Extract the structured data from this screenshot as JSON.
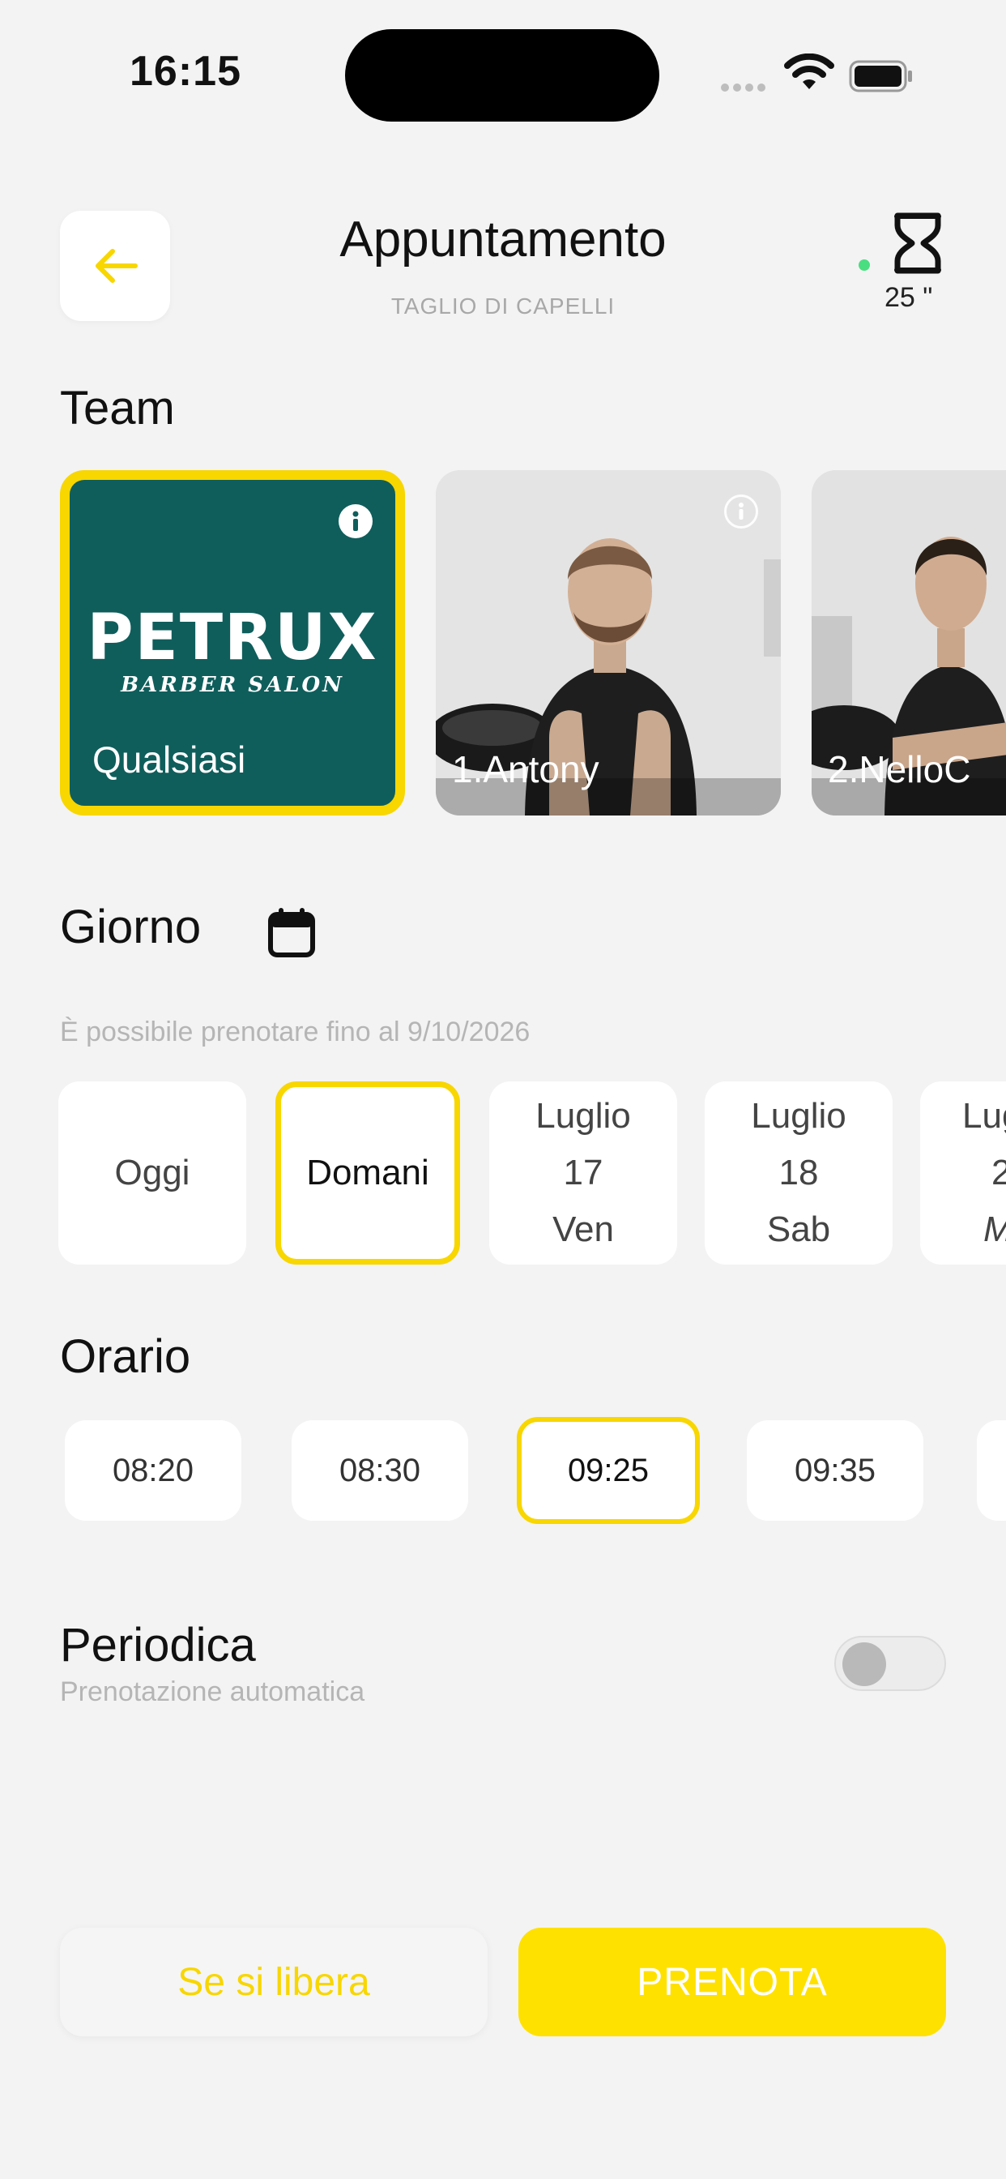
{
  "status_bar": {
    "time": "16:15"
  },
  "header": {
    "title": "Appuntamento",
    "subtitle": "TAGLIO DI CAPELLI",
    "duration": "25 \""
  },
  "team": {
    "title": "Team",
    "members": [
      {
        "name": "Qualsiasi",
        "logo": "PETRUX",
        "logo_sub": "BARBER SALON",
        "selected": true
      },
      {
        "name": "1.Antony",
        "selected": false
      },
      {
        "name": "2.NelloC",
        "selected": false
      }
    ]
  },
  "day": {
    "title": "Giorno",
    "note": "È possibile prenotare fino al 9/10/2026",
    "options": [
      {
        "line1": "Oggi"
      },
      {
        "line1": "Domani",
        "selected": true
      },
      {
        "line1": "Luglio",
        "line2": "17",
        "line3": "Ven"
      },
      {
        "line1": "Luglio",
        "line2": "18",
        "line3": "Sab"
      },
      {
        "line1": "Lug",
        "line2": "2",
        "line3": "M"
      }
    ]
  },
  "time": {
    "title": "Orario",
    "options": [
      "08:20",
      "08:30",
      "09:25",
      "09:35"
    ],
    "selected": "09:25"
  },
  "periodic": {
    "title": "Periodica",
    "subtitle": "Prenotazione automatica",
    "enabled": false
  },
  "actions": {
    "secondary": "Se si libera",
    "primary": "PRENOTA"
  },
  "colors": {
    "accent": "#f8d600",
    "brand": "#0f5e5c",
    "live": "#4ade80"
  }
}
